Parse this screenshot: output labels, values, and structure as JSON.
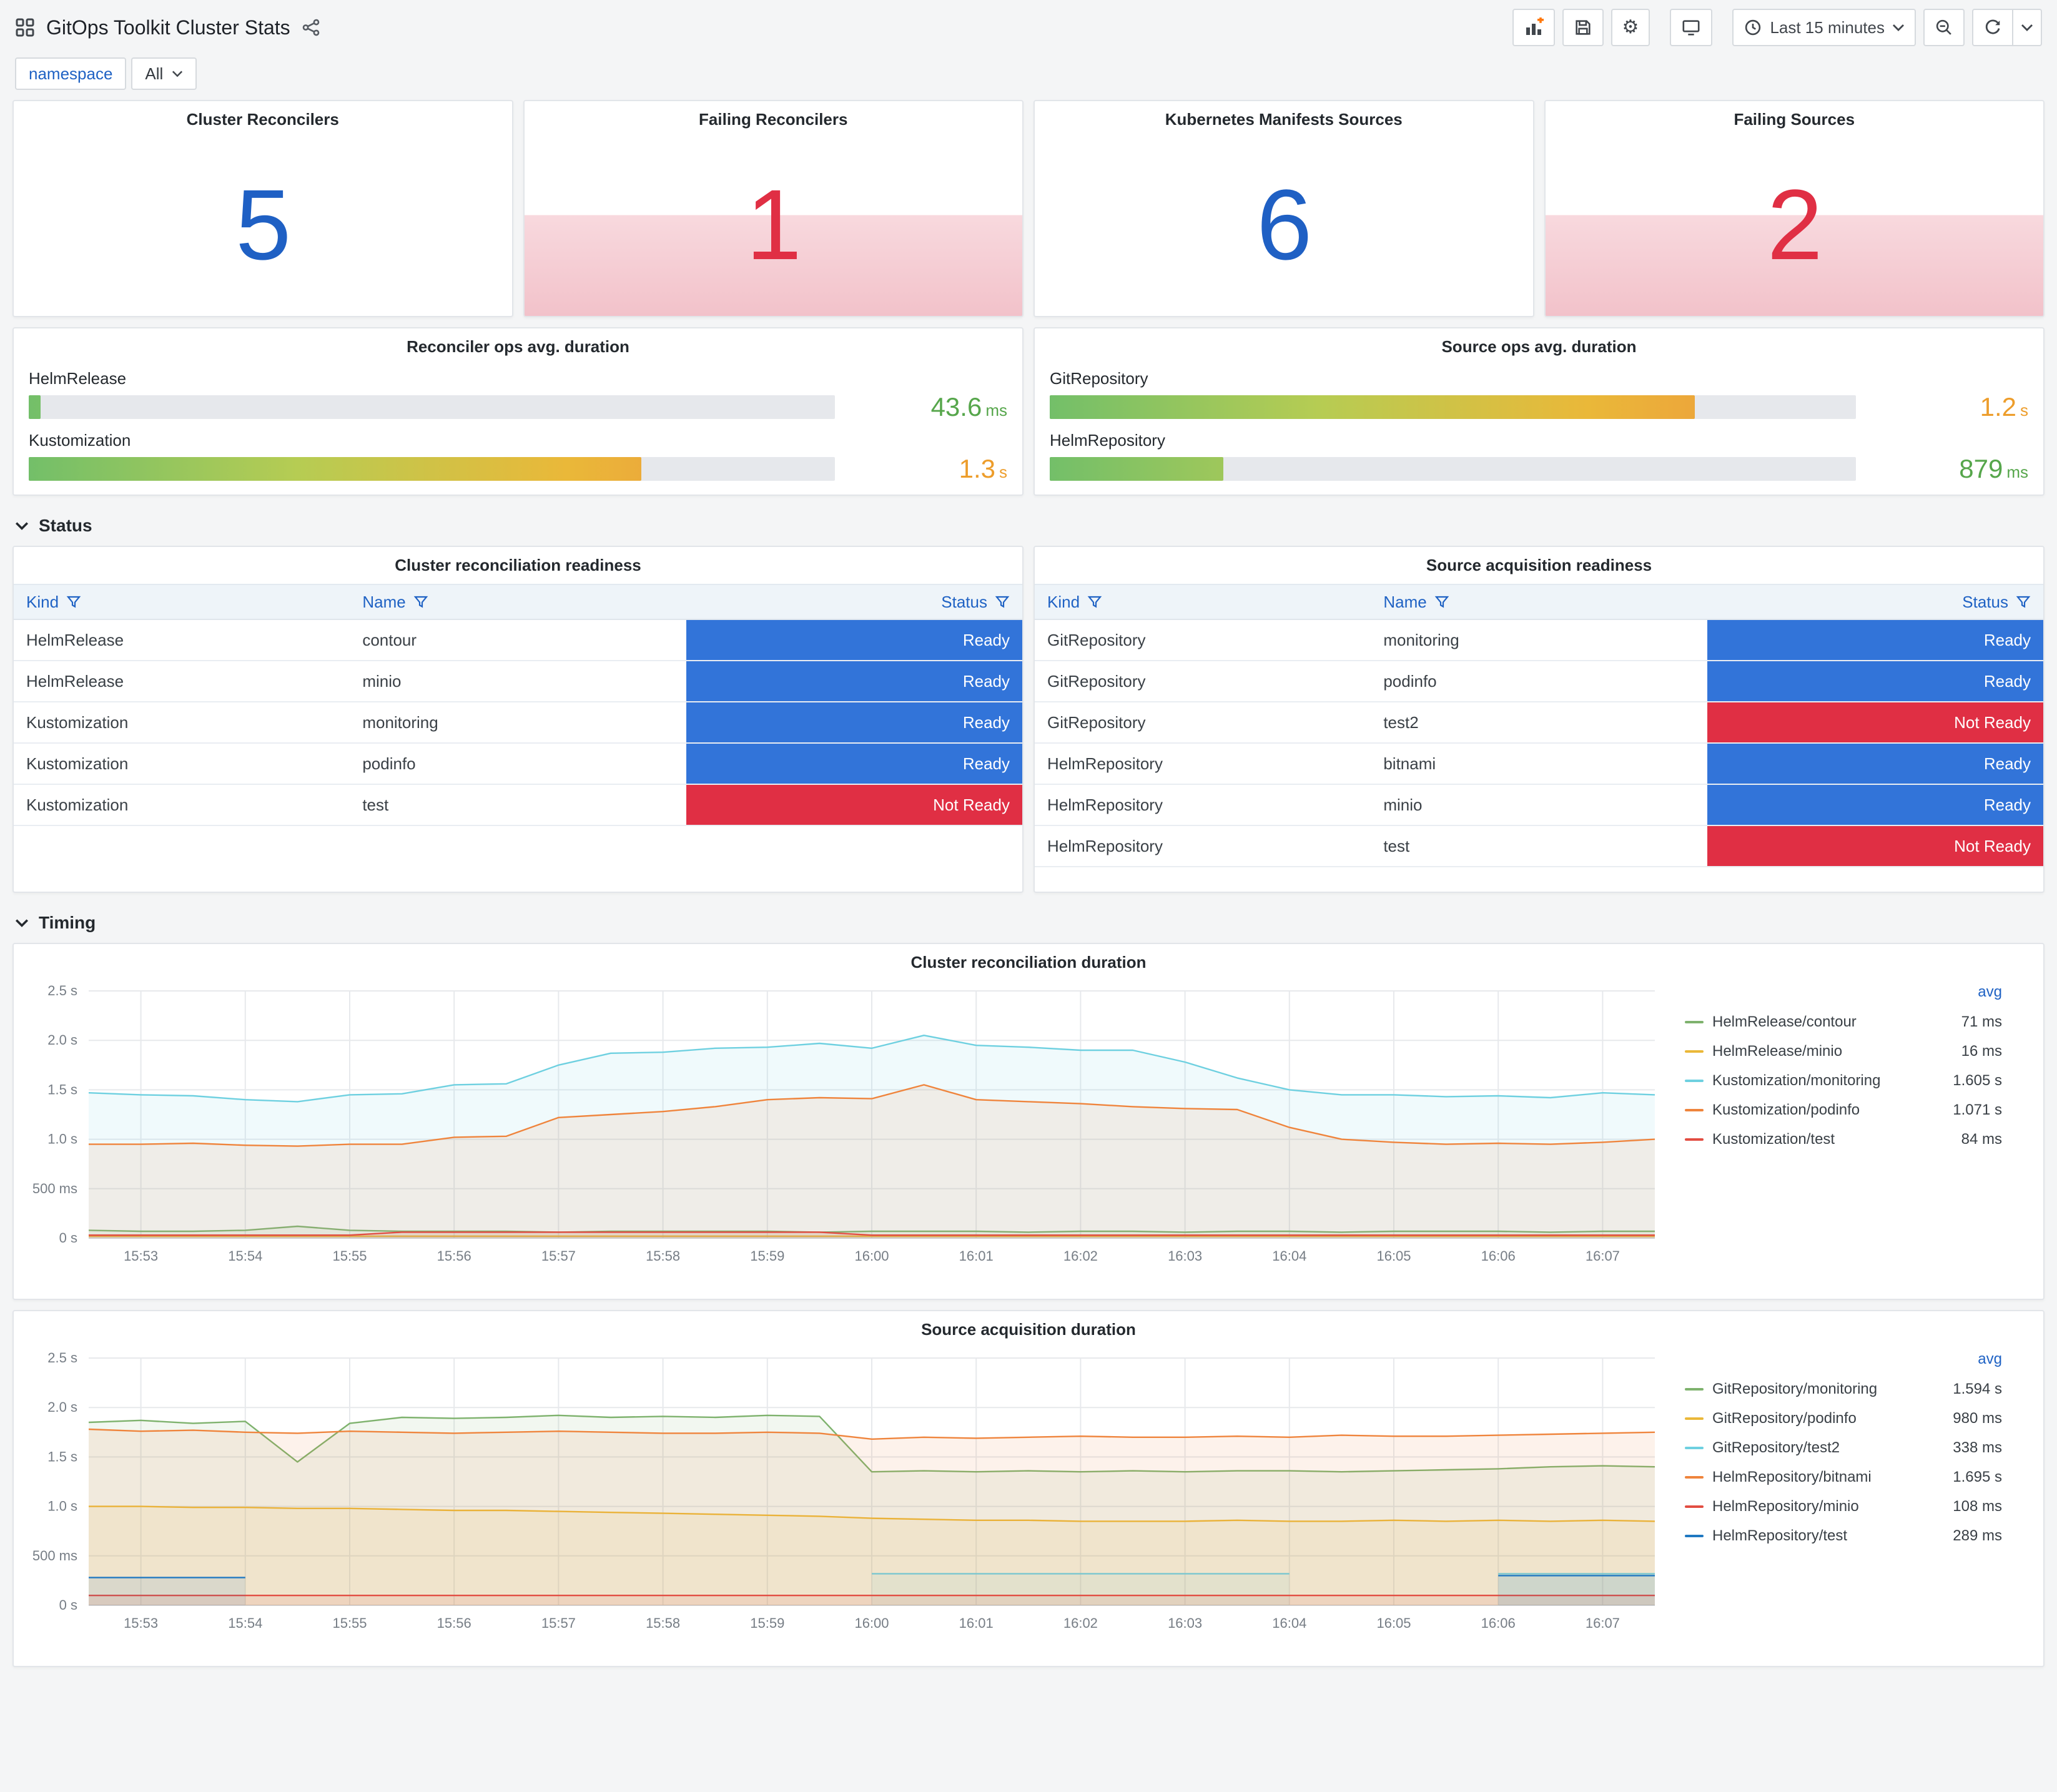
{
  "header": {
    "dashboard_title": "GitOps Toolkit Cluster Stats",
    "time_picker": {
      "label": "Last 15 minutes"
    }
  },
  "icons": [
    "dashboard-grid",
    "share",
    "panel-add",
    "save",
    "settings",
    "cycle-view",
    "clock",
    "caret-down",
    "zoom-out",
    "refresh",
    "filter-funnel",
    "chevron-down"
  ],
  "variables": {
    "namespace": {
      "label": "namespace",
      "value": "All"
    }
  },
  "colors": {
    "ok": "#1f60c4",
    "alert": "#e02f44",
    "ready_bg": "#3274d9",
    "not_ready_bg": "#e02f44",
    "gauge_gradient": [
      "#73BF69",
      "#B6CC53",
      "#EAB839",
      "#EF8E3C"
    ]
  },
  "stat_panels": [
    {
      "title": "Cluster Reconcilers",
      "value": "5",
      "state": "ok"
    },
    {
      "title": "Failing Reconcilers",
      "value": "1",
      "state": "alert"
    },
    {
      "title": "Kubernetes Manifests Sources",
      "value": "6",
      "state": "ok"
    },
    {
      "title": "Failing Sources",
      "value": "2",
      "state": "alert"
    }
  ],
  "gauge_panels": [
    {
      "title": "Reconciler ops avg. duration",
      "bars": [
        {
          "label": "HelmRelease",
          "value": "43.6",
          "unit": "ms",
          "percent": 1.5,
          "value_color": "#56a64b"
        },
        {
          "label": "Kustomization",
          "value": "1.3",
          "unit": "s",
          "percent": 76,
          "value_color": "#ed9d2b"
        }
      ]
    },
    {
      "title": "Source ops avg. duration",
      "bars": [
        {
          "label": "GitRepository",
          "value": "1.2",
          "unit": "s",
          "percent": 80,
          "value_color": "#ed9d2b"
        },
        {
          "label": "HelmRepository",
          "value": "879",
          "unit": "ms",
          "percent": 21.5,
          "value_color": "#56a64b"
        }
      ]
    }
  ],
  "sections": {
    "status": "Status",
    "timing": "Timing"
  },
  "tables": [
    {
      "title": "Cluster reconciliation readiness",
      "columns": [
        "Kind",
        "Name",
        "Status"
      ],
      "rows": [
        {
          "kind": "HelmRelease",
          "name": "contour",
          "status": "Ready"
        },
        {
          "kind": "HelmRelease",
          "name": "minio",
          "status": "Ready"
        },
        {
          "kind": "Kustomization",
          "name": "monitoring",
          "status": "Ready"
        },
        {
          "kind": "Kustomization",
          "name": "podinfo",
          "status": "Ready"
        },
        {
          "kind": "Kustomization",
          "name": "test",
          "status": "Not Ready"
        }
      ]
    },
    {
      "title": "Source acquisition readiness",
      "columns": [
        "Kind",
        "Name",
        "Status"
      ],
      "rows": [
        {
          "kind": "GitRepository",
          "name": "monitoring",
          "status": "Ready"
        },
        {
          "kind": "GitRepository",
          "name": "podinfo",
          "status": "Ready"
        },
        {
          "kind": "GitRepository",
          "name": "test2",
          "status": "Not Ready"
        },
        {
          "kind": "HelmRepository",
          "name": "bitnami",
          "status": "Ready"
        },
        {
          "kind": "HelmRepository",
          "name": "minio",
          "status": "Ready"
        },
        {
          "kind": "HelmRepository",
          "name": "test",
          "status": "Not Ready"
        }
      ]
    }
  ],
  "chart_data": [
    {
      "type": "area",
      "title": "Cluster reconciliation duration",
      "legend_header": "avg",
      "legend_position": "right",
      "grid": true,
      "ylim": [
        0,
        2.5
      ],
      "y_ticks": [
        {
          "v": 0,
          "label": "0 s"
        },
        {
          "v": 0.5,
          "label": "500 ms"
        },
        {
          "v": 1,
          "label": "1.0 s"
        },
        {
          "v": 1.5,
          "label": "1.5 s"
        },
        {
          "v": 2,
          "label": "2.0 s"
        },
        {
          "v": 2.5,
          "label": "2.5 s"
        }
      ],
      "x_ticks": [
        "15:53",
        "15:54",
        "15:55",
        "15:56",
        "15:57",
        "15:58",
        "15:59",
        "16:00",
        "16:01",
        "16:02",
        "16:03",
        "16:04",
        "16:05",
        "16:06",
        "16:07"
      ],
      "series": [
        {
          "name": "HelmRelease/contour",
          "avg": "71 ms",
          "color": "#7EB26D",
          "values": [
            0.08,
            0.07,
            0.07,
            0.08,
            0.12,
            0.08,
            0.07,
            0.07,
            0.07,
            0.06,
            0.07,
            0.07,
            0.07,
            0.07,
            0.06,
            0.07,
            0.07,
            0.07,
            0.06,
            0.07,
            0.07,
            0.06,
            0.07,
            0.07,
            0.06,
            0.07,
            0.07,
            0.07,
            0.06,
            0.07,
            0.07
          ]
        },
        {
          "name": "HelmRelease/minio",
          "avg": "16 ms",
          "color": "#EAB839",
          "values": [
            0.02,
            0.02,
            0.02,
            0.02,
            0.02,
            0.02,
            0.02,
            0.02,
            0.02,
            0.02,
            0.02,
            0.02,
            0.02,
            0.02,
            0.02,
            0.02,
            0.02,
            0.02,
            0.02,
            0.02,
            0.02,
            0.02,
            0.02,
            0.02,
            0.02,
            0.02,
            0.02,
            0.02,
            0.02,
            0.02,
            0.02
          ]
        },
        {
          "name": "Kustomization/monitoring",
          "avg": "1.605 s",
          "color": "#6ED0E0",
          "values": [
            1.47,
            1.45,
            1.44,
            1.4,
            1.38,
            1.45,
            1.46,
            1.55,
            1.56,
            1.75,
            1.87,
            1.88,
            1.92,
            1.93,
            1.97,
            1.92,
            2.05,
            1.95,
            1.93,
            1.9,
            1.9,
            1.78,
            1.62,
            1.5,
            1.45,
            1.45,
            1.43,
            1.44,
            1.42,
            1.47,
            1.45
          ]
        },
        {
          "name": "Kustomization/podinfo",
          "avg": "1.071 s",
          "color": "#EF843C",
          "values": [
            0.95,
            0.95,
            0.96,
            0.94,
            0.93,
            0.95,
            0.95,
            1.02,
            1.03,
            1.22,
            1.25,
            1.28,
            1.33,
            1.4,
            1.42,
            1.41,
            1.55,
            1.4,
            1.38,
            1.36,
            1.33,
            1.31,
            1.3,
            1.12,
            1.0,
            0.97,
            0.95,
            0.96,
            0.95,
            0.97,
            1.0
          ]
        },
        {
          "name": "Kustomization/test",
          "avg": "84 ms",
          "color": "#E24D42",
          "values": [
            0.03,
            0.03,
            0.03,
            0.03,
            0.03,
            0.03,
            0.06,
            0.06,
            0.06,
            0.06,
            0.06,
            0.06,
            0.06,
            0.06,
            0.06,
            0.03,
            0.03,
            0.03,
            0.03,
            0.03,
            0.03,
            0.03,
            0.03,
            0.03,
            0.03,
            0.03,
            0.03,
            0.03,
            0.03,
            0.03,
            0.03
          ]
        }
      ]
    },
    {
      "type": "area",
      "title": "Source acquisition duration",
      "legend_header": "avg",
      "legend_position": "right",
      "grid": true,
      "ylim": [
        0,
        2.5
      ],
      "y_ticks": [
        {
          "v": 0,
          "label": "0 s"
        },
        {
          "v": 0.5,
          "label": "500 ms"
        },
        {
          "v": 1,
          "label": "1.0 s"
        },
        {
          "v": 1.5,
          "label": "1.5 s"
        },
        {
          "v": 2,
          "label": "2.0 s"
        },
        {
          "v": 2.5,
          "label": "2.5 s"
        }
      ],
      "x_ticks": [
        "15:53",
        "15:54",
        "15:55",
        "15:56",
        "15:57",
        "15:58",
        "15:59",
        "16:00",
        "16:01",
        "16:02",
        "16:03",
        "16:04",
        "16:05",
        "16:06",
        "16:07"
      ],
      "series": [
        {
          "name": "GitRepository/monitoring",
          "avg": "1.594 s",
          "color": "#7EB26D",
          "values": [
            1.85,
            1.87,
            1.84,
            1.86,
            1.45,
            1.84,
            1.9,
            1.89,
            1.9,
            1.92,
            1.9,
            1.91,
            1.9,
            1.92,
            1.91,
            1.35,
            1.36,
            1.35,
            1.36,
            1.35,
            1.36,
            1.35,
            1.36,
            1.36,
            1.35,
            1.36,
            1.37,
            1.38,
            1.4,
            1.41,
            1.4
          ]
        },
        {
          "name": "GitRepository/podinfo",
          "avg": "980 ms",
          "color": "#EAB839",
          "values": [
            1.0,
            1.0,
            0.99,
            0.99,
            0.98,
            0.98,
            0.97,
            0.96,
            0.96,
            0.95,
            0.94,
            0.93,
            0.92,
            0.91,
            0.9,
            0.88,
            0.87,
            0.86,
            0.86,
            0.85,
            0.85,
            0.85,
            0.86,
            0.85,
            0.85,
            0.86,
            0.85,
            0.86,
            0.85,
            0.86,
            0.85
          ]
        },
        {
          "name": "GitRepository/test2",
          "avg": "338 ms",
          "color": "#6ED0E0",
          "values": [
            null,
            null,
            null,
            null,
            null,
            null,
            null,
            null,
            null,
            null,
            null,
            null,
            null,
            null,
            null,
            0.32,
            0.32,
            0.32,
            0.32,
            0.32,
            0.32,
            0.32,
            0.32,
            0.32,
            null,
            null,
            null,
            0.32,
            0.32,
            0.32,
            0.32
          ]
        },
        {
          "name": "HelmRepository/bitnami",
          "avg": "1.695 s",
          "color": "#EF843C",
          "values": [
            1.78,
            1.76,
            1.77,
            1.75,
            1.74,
            1.76,
            1.75,
            1.74,
            1.75,
            1.76,
            1.75,
            1.74,
            1.74,
            1.75,
            1.74,
            1.68,
            1.7,
            1.69,
            1.7,
            1.71,
            1.7,
            1.7,
            1.71,
            1.7,
            1.72,
            1.71,
            1.71,
            1.72,
            1.73,
            1.74,
            1.75
          ]
        },
        {
          "name": "HelmRepository/minio",
          "avg": "108 ms",
          "color": "#E24D42",
          "values": [
            0.1,
            0.1,
            0.1,
            0.1,
            0.1,
            0.1,
            0.1,
            0.1,
            0.1,
            0.1,
            0.1,
            0.1,
            0.1,
            0.1,
            0.1,
            0.1,
            0.1,
            0.1,
            0.1,
            0.1,
            0.1,
            0.1,
            0.1,
            0.1,
            0.1,
            0.1,
            0.1,
            0.1,
            0.1,
            0.1,
            0.1
          ]
        },
        {
          "name": "HelmRepository/test",
          "avg": "289 ms",
          "color": "#1F78C1",
          "values": [
            0.28,
            0.28,
            0.28,
            0.28,
            null,
            null,
            null,
            null,
            null,
            null,
            null,
            null,
            null,
            null,
            null,
            null,
            null,
            null,
            null,
            null,
            null,
            null,
            null,
            null,
            null,
            null,
            null,
            0.3,
            0.3,
            0.3,
            0.3
          ]
        }
      ]
    }
  ]
}
